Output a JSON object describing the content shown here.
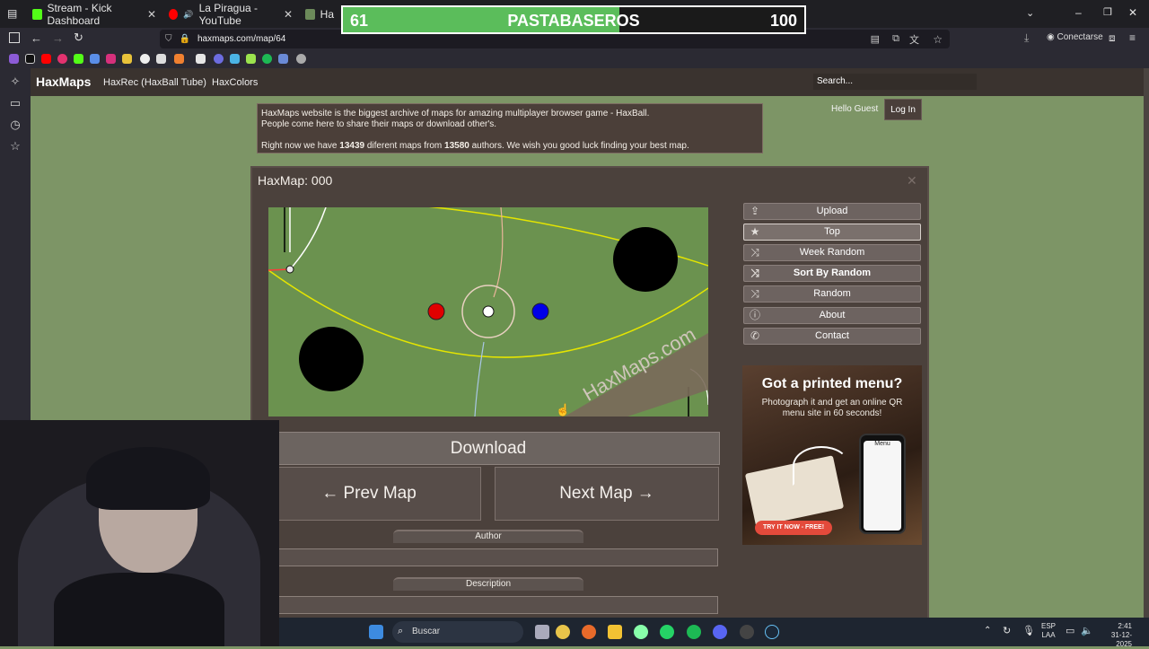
{
  "browser": {
    "tabs": [
      {
        "title": "Stream - Kick Dashboard",
        "icon": "kick-icon"
      },
      {
        "title": "La Piragua - YouTube",
        "icon": "youtube-icon"
      },
      {
        "title": "Ha",
        "icon": "haxmaps-icon"
      }
    ],
    "url": "haxmaps.com/map/64",
    "connect_label": "Conectarse"
  },
  "scoreboard": {
    "left": "61",
    "team": "PASTABASEROS",
    "right": "100",
    "progress": 0.6
  },
  "site": {
    "logo": "HaxMaps",
    "nav": [
      "HaxRec (HaxBall Tube)",
      "HaxColors"
    ],
    "search_placeholder": "Search...",
    "greeting": "Hello Guest",
    "login_label": "Log In"
  },
  "intro": {
    "line1": "HaxMaps website is the biggest archive of maps for amazing multiplayer browser game - HaxBall.",
    "line2": "People come here to share their maps or download other's.",
    "line3_a": "Right now we have ",
    "maps_count": "13439",
    "line3_b": " diferent maps from ",
    "authors_count": "13580",
    "line3_c": " authors. We wish you good luck finding your best map."
  },
  "map": {
    "title": "HaxMap: 000",
    "watermark": "HaxMaps.com"
  },
  "menu": [
    {
      "label": "Upload",
      "icon": "upload-icon"
    },
    {
      "label": "Top",
      "icon": "star-icon"
    },
    {
      "label": "Week Random",
      "icon": "shuffle-icon"
    },
    {
      "label": "Sort By Random",
      "icon": "shuffle-icon"
    },
    {
      "label": "Random",
      "icon": "shuffle-icon"
    },
    {
      "label": "About",
      "icon": "info-icon"
    },
    {
      "label": "Contact",
      "icon": "phone-icon"
    }
  ],
  "ad": {
    "headline": "Got a printed menu?",
    "body": "Photograph it and get an online QR menu site in 60 seconds!",
    "cta": "TRY IT NOW - FREE!",
    "phone_title": "Menu"
  },
  "actions": {
    "download": "Download",
    "prev": "← Prev Map",
    "next": "Next Map →",
    "author_label": "Author",
    "description_label": "Description"
  },
  "taskbar": {
    "search": "Buscar",
    "lang": "ESP",
    "region": "LAA",
    "time": "2:41",
    "date": "31-12-2025"
  },
  "colors": {
    "site_bg": "#7d9566",
    "panel": "#4b413c",
    "score_fill": "#5bbd5b"
  }
}
